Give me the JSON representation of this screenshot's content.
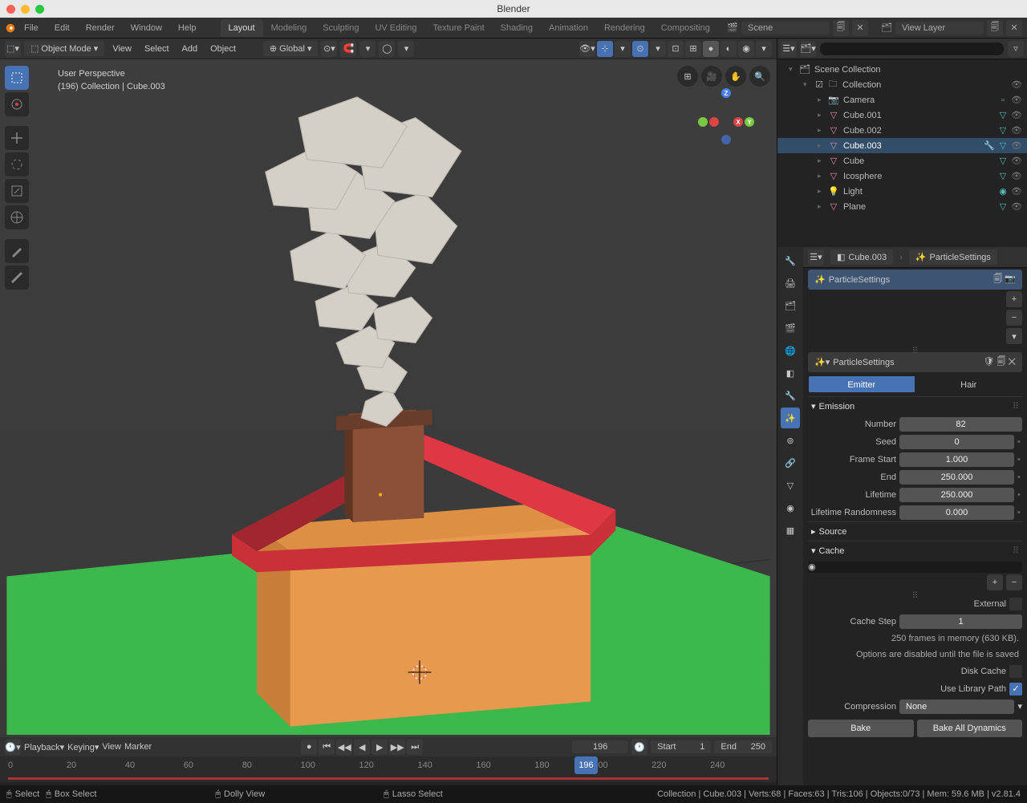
{
  "app": {
    "title": "Blender"
  },
  "menu": [
    "File",
    "Edit",
    "Render",
    "Window",
    "Help"
  ],
  "workspace_tabs": [
    "Layout",
    "Modeling",
    "Sculpting",
    "UV Editing",
    "Texture Paint",
    "Shading",
    "Animation",
    "Rendering",
    "Compositing"
  ],
  "active_workspace": "Layout",
  "scene": {
    "label": "Scene",
    "layer": "View Layer"
  },
  "viewport": {
    "mode": "Object Mode",
    "menus": [
      "View",
      "Select",
      "Add",
      "Object"
    ],
    "orientation": "Global",
    "overlay1": "User Perspective",
    "overlay2": "(196) Collection | Cube.003"
  },
  "outliner": {
    "root": "Scene Collection",
    "collection": "Collection",
    "items": [
      {
        "name": "Camera",
        "icon": "cam",
        "extra": "render"
      },
      {
        "name": "Cube.001",
        "icon": "mesh",
        "extra": "mat"
      },
      {
        "name": "Cube.002",
        "icon": "mesh",
        "extra": "mat"
      },
      {
        "name": "Cube.003",
        "icon": "mesh",
        "selected": true,
        "extra": "mod"
      },
      {
        "name": "Cube",
        "icon": "mesh",
        "extra": "mat"
      },
      {
        "name": "Icosphere",
        "icon": "mesh",
        "extra": "mat"
      },
      {
        "name": "Light",
        "icon": "light",
        "extra": "data"
      },
      {
        "name": "Plane",
        "icon": "mesh",
        "extra": "mat"
      }
    ]
  },
  "properties": {
    "context_obj": "Cube.003",
    "context_ps": "ParticleSettings",
    "settings_name": "ParticleSettings",
    "datablock": "ParticleSettings",
    "type_emitter": "Emitter",
    "type_hair": "Hair",
    "emission": {
      "title": "Emission",
      "number": "82",
      "seed": "0",
      "frame_start": "1.000",
      "end": "250.000",
      "lifetime": "250.000",
      "lifetime_rand": "0.000",
      "labels": {
        "number": "Number",
        "seed": "Seed",
        "frame_start": "Frame Start",
        "end": "End",
        "lifetime": "Lifetime",
        "lifetime_rand": "Lifetime Randomness"
      }
    },
    "source_title": "Source",
    "cache": {
      "title": "Cache",
      "external": "External",
      "cache_step_label": "Cache Step",
      "cache_step": "1",
      "frames_msg": "250 frames in memory (630 KB).",
      "opts_msg": "Options are disabled until the file is saved",
      "disk_cache": "Disk Cache",
      "lib_path": "Use Library Path",
      "compression_label": "Compression",
      "compression": "None",
      "bake": "Bake",
      "bake_all": "Bake All Dynamics"
    }
  },
  "timeline": {
    "playback": "Playback",
    "keying": "Keying",
    "view": "View",
    "marker": "Marker",
    "current": "196",
    "start_label": "Start",
    "start": "1",
    "end_label": "End",
    "end": "250",
    "ticks": [
      "0",
      "20",
      "40",
      "60",
      "80",
      "100",
      "120",
      "140",
      "160",
      "180",
      "200",
      "220",
      "240"
    ],
    "cursor": "196"
  },
  "status": {
    "left": [
      [
        "mouse",
        "Select"
      ],
      [
        "mouse",
        "Box Select"
      ],
      [
        "mouse",
        "Dolly View"
      ],
      [
        "mouse",
        "Lasso Select"
      ]
    ],
    "right": "Collection | Cube.003 | Verts:68 | Faces:63 | Tris:106 | Objects:0/73 | Mem: 59.6 MB | v2.81.4"
  }
}
